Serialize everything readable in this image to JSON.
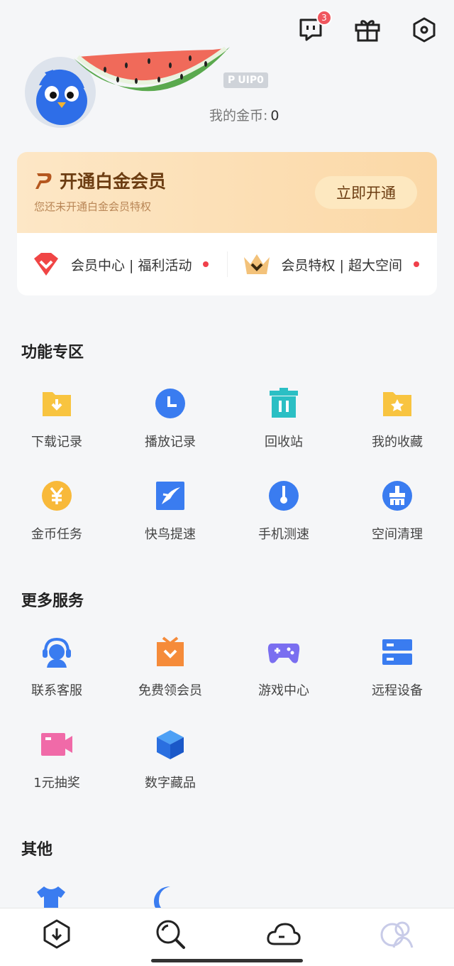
{
  "header": {
    "message_badge": "3"
  },
  "profile": {
    "vip_level": "UIP0",
    "coins_label": "我的金币:",
    "coins_value": "0"
  },
  "vip_card": {
    "title": "开通白金会员",
    "subtitle": "您还未开通白金会员特权",
    "button": "立即开通",
    "links": [
      {
        "label": "会员中心 | 福利活动"
      },
      {
        "label": "会员特权 | 超大空间"
      }
    ]
  },
  "sections": {
    "features": {
      "title": "功能专区",
      "items": [
        {
          "label": "下载记录",
          "icon": "download-folder-icon"
        },
        {
          "label": "播放记录",
          "icon": "clock-icon"
        },
        {
          "label": "回收站",
          "icon": "trash-icon"
        },
        {
          "label": "我的收藏",
          "icon": "star-folder-icon"
        },
        {
          "label": "金币任务",
          "icon": "coin-icon"
        },
        {
          "label": "快鸟提速",
          "icon": "bird-icon"
        },
        {
          "label": "手机测速",
          "icon": "speedometer-icon"
        },
        {
          "label": "空间清理",
          "icon": "broom-icon"
        }
      ]
    },
    "services": {
      "title": "更多服务",
      "items": [
        {
          "label": "联系客服",
          "icon": "headset-icon"
        },
        {
          "label": "免费领会员",
          "icon": "gift-box-icon"
        },
        {
          "label": "游戏中心",
          "icon": "gamepad-icon"
        },
        {
          "label": "远程设备",
          "icon": "server-icon"
        },
        {
          "label": "1元抽奖",
          "icon": "video-camera-icon"
        },
        {
          "label": "数字藏品",
          "icon": "cube-icon"
        }
      ]
    },
    "other": {
      "title": "其他"
    }
  },
  "colors": {
    "accent_blue": "#3a7cf0",
    "folder_yellow": "#f8c440",
    "teal": "#2bbfc4",
    "vip_brown": "#6c3d12",
    "red_dot": "#f0404a"
  }
}
